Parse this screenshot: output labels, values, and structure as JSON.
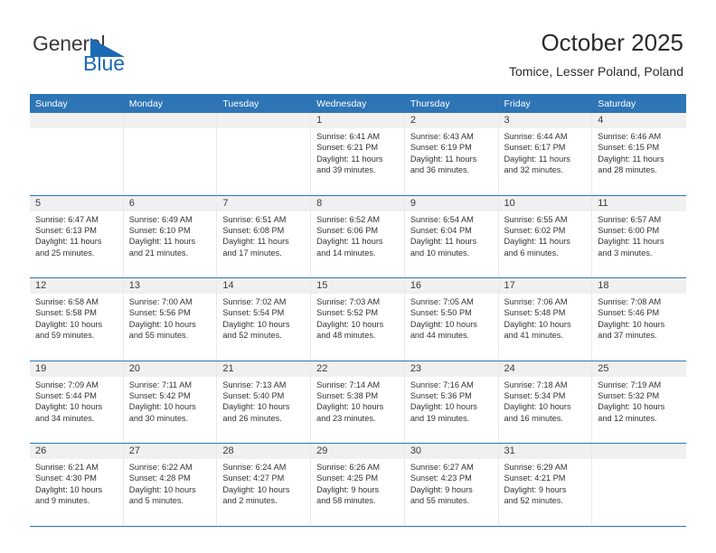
{
  "brand": {
    "name_top": "General",
    "name_bottom": "Blue",
    "triangle_color": "#1c6ab4",
    "text_color": "#3b3b3b"
  },
  "header": {
    "title": "October 2025",
    "location": "Tomice, Lesser Poland, Poland"
  },
  "theme": {
    "header_blue": "#2e75b6",
    "daynum_band": "#f0f0f0",
    "cell_border": "#e9e9e9"
  },
  "weekdays": [
    "Sunday",
    "Monday",
    "Tuesday",
    "Wednesday",
    "Thursday",
    "Friday",
    "Saturday"
  ],
  "labels": {
    "sunrise": "Sunrise:",
    "sunset": "Sunset:",
    "daylight": "Daylight:"
  },
  "weeks": [
    [
      {
        "day": "",
        "empty": true
      },
      {
        "day": "",
        "empty": true
      },
      {
        "day": "",
        "empty": true
      },
      {
        "day": "1",
        "sunrise": "Sunrise: 6:41 AM",
        "sunset": "Sunset: 6:21 PM",
        "daylight1": "Daylight: 11 hours",
        "daylight2": "and 39 minutes."
      },
      {
        "day": "2",
        "sunrise": "Sunrise: 6:43 AM",
        "sunset": "Sunset: 6:19 PM",
        "daylight1": "Daylight: 11 hours",
        "daylight2": "and 36 minutes."
      },
      {
        "day": "3",
        "sunrise": "Sunrise: 6:44 AM",
        "sunset": "Sunset: 6:17 PM",
        "daylight1": "Daylight: 11 hours",
        "daylight2": "and 32 minutes."
      },
      {
        "day": "4",
        "sunrise": "Sunrise: 6:46 AM",
        "sunset": "Sunset: 6:15 PM",
        "daylight1": "Daylight: 11 hours",
        "daylight2": "and 28 minutes."
      }
    ],
    [
      {
        "day": "5",
        "sunrise": "Sunrise: 6:47 AM",
        "sunset": "Sunset: 6:13 PM",
        "daylight1": "Daylight: 11 hours",
        "daylight2": "and 25 minutes."
      },
      {
        "day": "6",
        "sunrise": "Sunrise: 6:49 AM",
        "sunset": "Sunset: 6:10 PM",
        "daylight1": "Daylight: 11 hours",
        "daylight2": "and 21 minutes."
      },
      {
        "day": "7",
        "sunrise": "Sunrise: 6:51 AM",
        "sunset": "Sunset: 6:08 PM",
        "daylight1": "Daylight: 11 hours",
        "daylight2": "and 17 minutes."
      },
      {
        "day": "8",
        "sunrise": "Sunrise: 6:52 AM",
        "sunset": "Sunset: 6:06 PM",
        "daylight1": "Daylight: 11 hours",
        "daylight2": "and 14 minutes."
      },
      {
        "day": "9",
        "sunrise": "Sunrise: 6:54 AM",
        "sunset": "Sunset: 6:04 PM",
        "daylight1": "Daylight: 11 hours",
        "daylight2": "and 10 minutes."
      },
      {
        "day": "10",
        "sunrise": "Sunrise: 6:55 AM",
        "sunset": "Sunset: 6:02 PM",
        "daylight1": "Daylight: 11 hours",
        "daylight2": "and 6 minutes."
      },
      {
        "day": "11",
        "sunrise": "Sunrise: 6:57 AM",
        "sunset": "Sunset: 6:00 PM",
        "daylight1": "Daylight: 11 hours",
        "daylight2": "and 3 minutes."
      }
    ],
    [
      {
        "day": "12",
        "sunrise": "Sunrise: 6:58 AM",
        "sunset": "Sunset: 5:58 PM",
        "daylight1": "Daylight: 10 hours",
        "daylight2": "and 59 minutes."
      },
      {
        "day": "13",
        "sunrise": "Sunrise: 7:00 AM",
        "sunset": "Sunset: 5:56 PM",
        "daylight1": "Daylight: 10 hours",
        "daylight2": "and 55 minutes."
      },
      {
        "day": "14",
        "sunrise": "Sunrise: 7:02 AM",
        "sunset": "Sunset: 5:54 PM",
        "daylight1": "Daylight: 10 hours",
        "daylight2": "and 52 minutes."
      },
      {
        "day": "15",
        "sunrise": "Sunrise: 7:03 AM",
        "sunset": "Sunset: 5:52 PM",
        "daylight1": "Daylight: 10 hours",
        "daylight2": "and 48 minutes."
      },
      {
        "day": "16",
        "sunrise": "Sunrise: 7:05 AM",
        "sunset": "Sunset: 5:50 PM",
        "daylight1": "Daylight: 10 hours",
        "daylight2": "and 44 minutes."
      },
      {
        "day": "17",
        "sunrise": "Sunrise: 7:06 AM",
        "sunset": "Sunset: 5:48 PM",
        "daylight1": "Daylight: 10 hours",
        "daylight2": "and 41 minutes."
      },
      {
        "day": "18",
        "sunrise": "Sunrise: 7:08 AM",
        "sunset": "Sunset: 5:46 PM",
        "daylight1": "Daylight: 10 hours",
        "daylight2": "and 37 minutes."
      }
    ],
    [
      {
        "day": "19",
        "sunrise": "Sunrise: 7:09 AM",
        "sunset": "Sunset: 5:44 PM",
        "daylight1": "Daylight: 10 hours",
        "daylight2": "and 34 minutes."
      },
      {
        "day": "20",
        "sunrise": "Sunrise: 7:11 AM",
        "sunset": "Sunset: 5:42 PM",
        "daylight1": "Daylight: 10 hours",
        "daylight2": "and 30 minutes."
      },
      {
        "day": "21",
        "sunrise": "Sunrise: 7:13 AM",
        "sunset": "Sunset: 5:40 PM",
        "daylight1": "Daylight: 10 hours",
        "daylight2": "and 26 minutes."
      },
      {
        "day": "22",
        "sunrise": "Sunrise: 7:14 AM",
        "sunset": "Sunset: 5:38 PM",
        "daylight1": "Daylight: 10 hours",
        "daylight2": "and 23 minutes."
      },
      {
        "day": "23",
        "sunrise": "Sunrise: 7:16 AM",
        "sunset": "Sunset: 5:36 PM",
        "daylight1": "Daylight: 10 hours",
        "daylight2": "and 19 minutes."
      },
      {
        "day": "24",
        "sunrise": "Sunrise: 7:18 AM",
        "sunset": "Sunset: 5:34 PM",
        "daylight1": "Daylight: 10 hours",
        "daylight2": "and 16 minutes."
      },
      {
        "day": "25",
        "sunrise": "Sunrise: 7:19 AM",
        "sunset": "Sunset: 5:32 PM",
        "daylight1": "Daylight: 10 hours",
        "daylight2": "and 12 minutes."
      }
    ],
    [
      {
        "day": "26",
        "sunrise": "Sunrise: 6:21 AM",
        "sunset": "Sunset: 4:30 PM",
        "daylight1": "Daylight: 10 hours",
        "daylight2": "and 9 minutes."
      },
      {
        "day": "27",
        "sunrise": "Sunrise: 6:22 AM",
        "sunset": "Sunset: 4:28 PM",
        "daylight1": "Daylight: 10 hours",
        "daylight2": "and 5 minutes."
      },
      {
        "day": "28",
        "sunrise": "Sunrise: 6:24 AM",
        "sunset": "Sunset: 4:27 PM",
        "daylight1": "Daylight: 10 hours",
        "daylight2": "and 2 minutes."
      },
      {
        "day": "29",
        "sunrise": "Sunrise: 6:26 AM",
        "sunset": "Sunset: 4:25 PM",
        "daylight1": "Daylight: 9 hours",
        "daylight2": "and 58 minutes."
      },
      {
        "day": "30",
        "sunrise": "Sunrise: 6:27 AM",
        "sunset": "Sunset: 4:23 PM",
        "daylight1": "Daylight: 9 hours",
        "daylight2": "and 55 minutes."
      },
      {
        "day": "31",
        "sunrise": "Sunrise: 6:29 AM",
        "sunset": "Sunset: 4:21 PM",
        "daylight1": "Daylight: 9 hours",
        "daylight2": "and 52 minutes."
      },
      {
        "day": "",
        "empty": true
      }
    ]
  ]
}
